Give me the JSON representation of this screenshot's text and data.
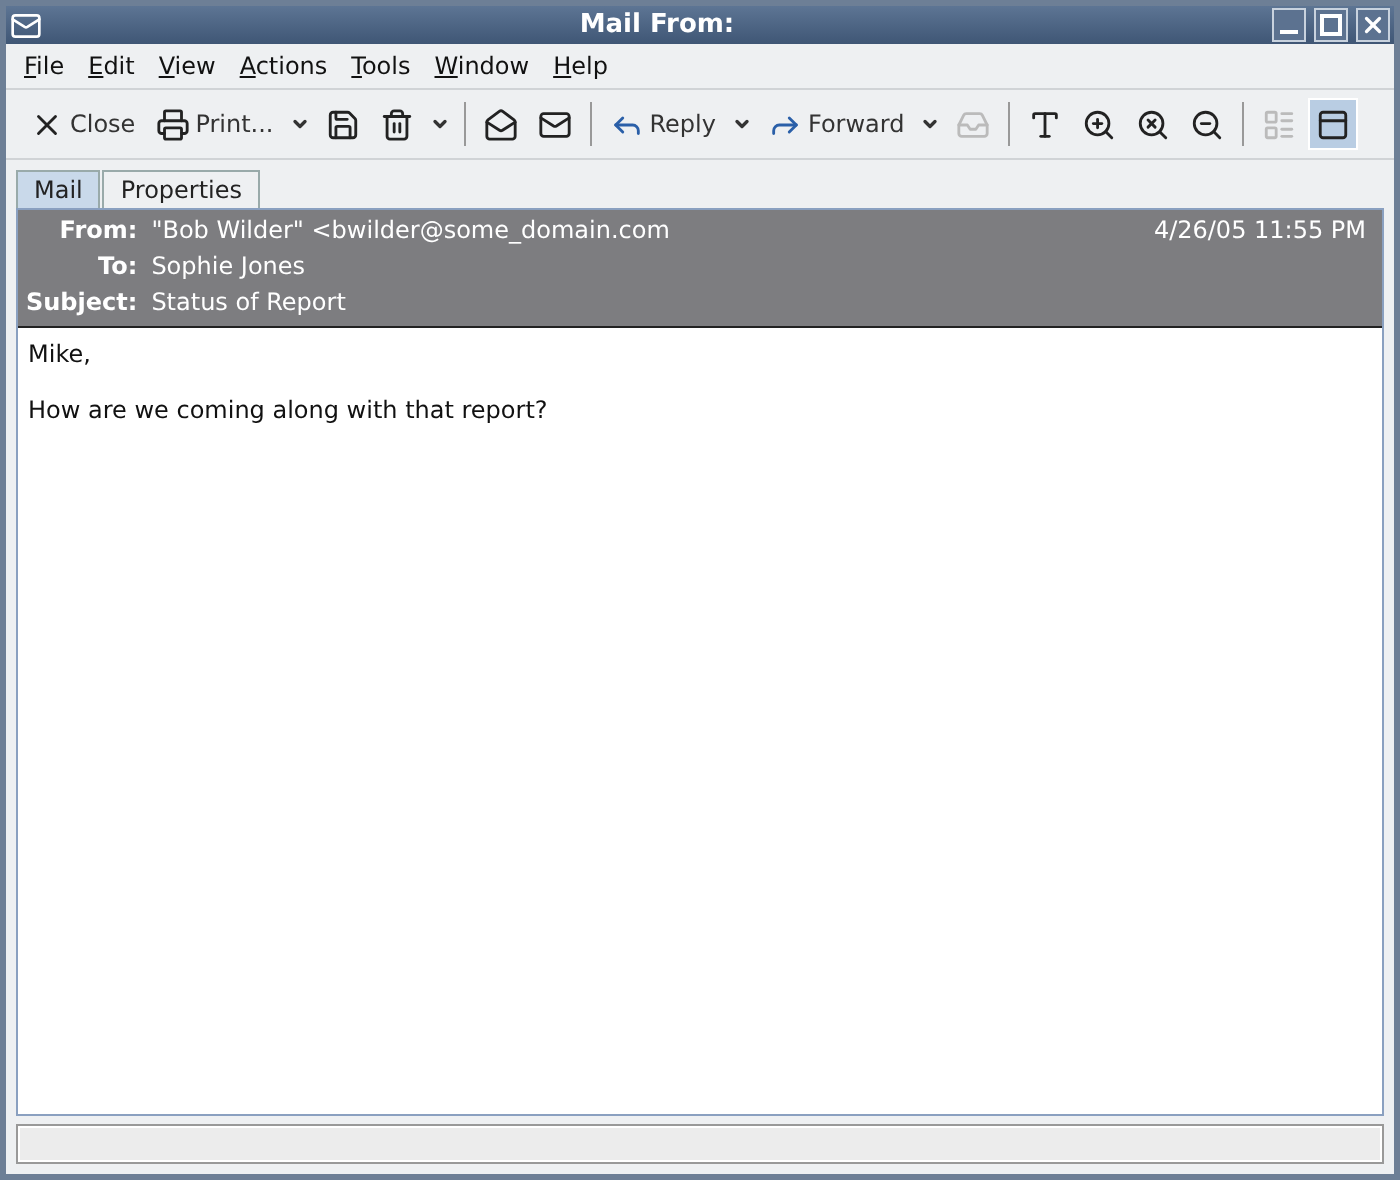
{
  "window": {
    "title": "Mail From:"
  },
  "menu": [
    "File",
    "Edit",
    "View",
    "Actions",
    "Tools",
    "Window",
    "Help"
  ],
  "toolbar": [
    {
      "kind": "button",
      "label": "Close",
      "disabled": false,
      "selected": false
    },
    {
      "kind": "button",
      "label": "Print...",
      "disabled": false,
      "selected": false
    },
    {
      "kind": "dropdown"
    },
    {
      "kind": "button",
      "disabled": false,
      "selected": false
    },
    {
      "kind": "button",
      "disabled": false,
      "selected": false
    },
    {
      "kind": "dropdown"
    },
    {
      "kind": "separator"
    },
    {
      "kind": "button",
      "disabled": false,
      "selected": false
    },
    {
      "kind": "button",
      "disabled": false,
      "selected": false
    },
    {
      "kind": "separator"
    },
    {
      "kind": "button",
      "label": "Reply",
      "disabled": false,
      "selected": false
    },
    {
      "kind": "dropdown"
    },
    {
      "kind": "button",
      "label": "Forward",
      "disabled": false,
      "selected": false
    },
    {
      "kind": "dropdown"
    },
    {
      "kind": "button",
      "disabled": true,
      "selected": false
    },
    {
      "kind": "separator"
    },
    {
      "kind": "button",
      "disabled": false,
      "selected": false
    },
    {
      "kind": "button",
      "disabled": false,
      "selected": false
    },
    {
      "kind": "button",
      "disabled": false,
      "selected": false
    },
    {
      "kind": "button",
      "disabled": false,
      "selected": false
    },
    {
      "kind": "separator"
    },
    {
      "kind": "button",
      "disabled": true,
      "selected": false
    },
    {
      "kind": "button",
      "disabled": false,
      "selected": true
    }
  ],
  "tabs": [
    {
      "label": "Mail",
      "selected": true
    },
    {
      "label": "Properties",
      "selected": false
    }
  ],
  "header": {
    "fields": [
      {
        "label": "From:",
        "value": "\"Bob Wilder\" <bwilder@some_domain.com"
      },
      {
        "label": "To:",
        "value": "Sophie Jones"
      },
      {
        "label": "Subject:",
        "value": "Status of Report"
      }
    ],
    "date": "4/26/05 11:55 PM"
  },
  "body": [
    "Mike,",
    "How are we coming along with that report?"
  ]
}
